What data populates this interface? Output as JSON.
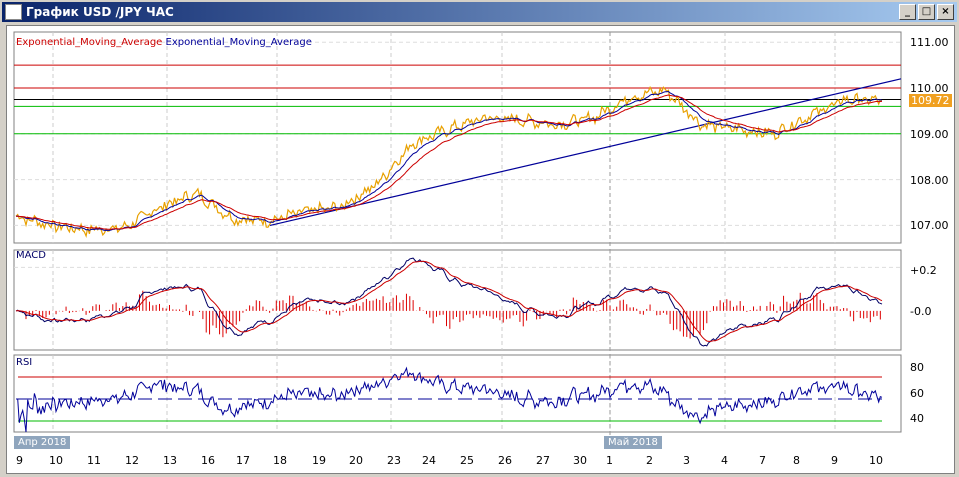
{
  "window": {
    "title": "График USD /JPY  ЧАС",
    "buttons": [
      "_",
      "□",
      "×"
    ]
  },
  "legend": [
    {
      "label": "Exponential_Moving_Average",
      "color": "#cc0000"
    },
    {
      "label": "Exponential_Moving_Average",
      "color": "#000099"
    }
  ],
  "panels": {
    "macd_label": "MACD",
    "rsi_label": "RSI"
  },
  "price_axis": [
    "111.00",
    "110.00",
    "109.00",
    "108.00",
    "107.00"
  ],
  "current_price": "109.72",
  "macd_axis": [
    "+0.2",
    "-0.0"
  ],
  "rsi_axis": [
    "80",
    "60",
    "40"
  ],
  "months": [
    "Апр 2018",
    "Май 2018"
  ],
  "dates": [
    "9",
    "10",
    "11",
    "12",
    "13",
    "16",
    "17",
    "18",
    "19",
    "20",
    "23",
    "24",
    "25",
    "26",
    "27",
    "30",
    "1",
    "2",
    "3",
    "4",
    "7",
    "8",
    "9",
    "10"
  ],
  "colors": {
    "price": "#e8a000",
    "ema_fast": "#000099",
    "ema_slow": "#cc0000",
    "macd_hist": "#dd0000",
    "rsi_overbought": "#cc00cc",
    "support": "#00bb00",
    "resistance": "#cc0000"
  },
  "chart_data": {
    "type": "line",
    "title": "USD/JPY H1",
    "price_levels": {
      "resistance": [
        110.5,
        110.0
      ],
      "current": 109.75,
      "support": [
        109.6,
        109.0
      ]
    },
    "trendline": {
      "from": {
        "date": "18",
        "price": 107.0
      },
      "to": {
        "date": "10",
        "price": 110.2
      }
    },
    "ylim": [
      106.6,
      111.2
    ],
    "price_by_day": [
      107.2,
      107.0,
      106.9,
      106.95,
      107.4,
      107.7,
      107.15,
      107.1,
      107.3,
      107.4,
      107.9,
      108.8,
      109.1,
      109.35,
      109.3,
      109.2,
      109.35,
      109.8,
      109.95,
      109.2,
      109.1,
      109.0,
      109.4,
      109.75,
      109.72
    ],
    "rsi_levels": [
      70,
      50,
      30
    ],
    "rsi_ylim": [
      20,
      90
    ],
    "macd_ylim": [
      -0.18,
      0.28
    ]
  }
}
